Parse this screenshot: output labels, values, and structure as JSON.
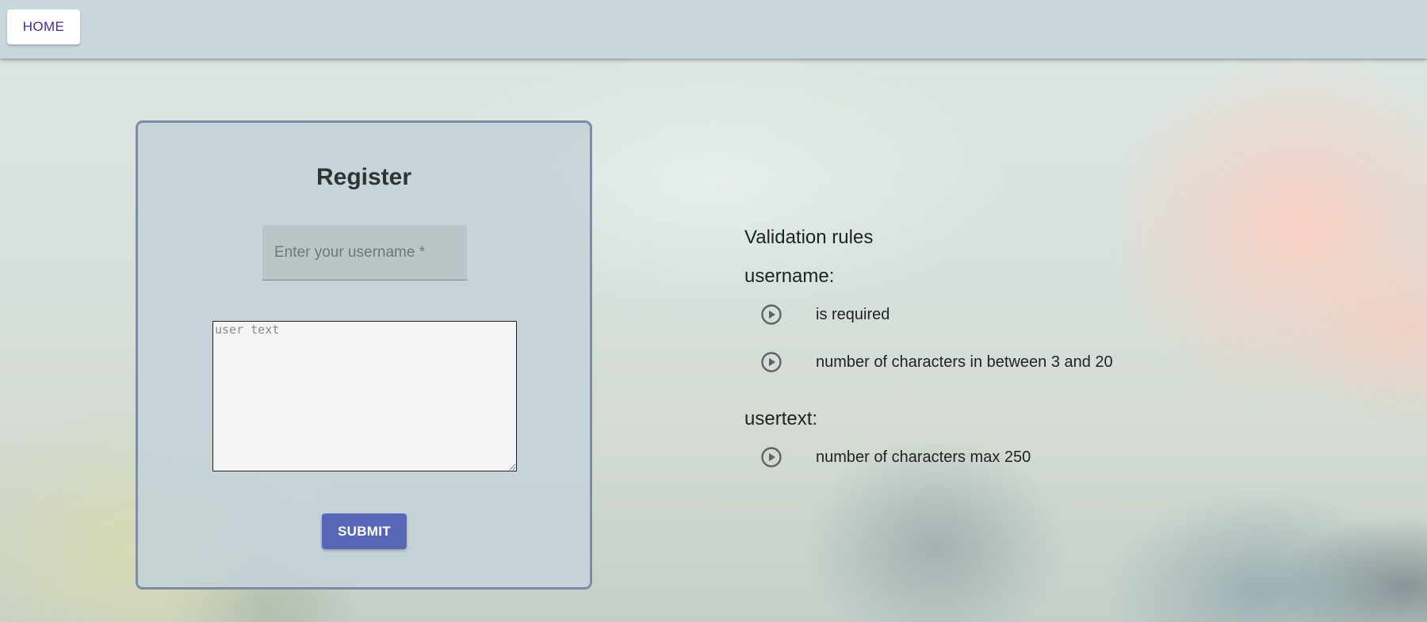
{
  "app_bar": {
    "home_label": "HOME"
  },
  "register_form": {
    "title": "Register",
    "username_placeholder": "Enter your username *",
    "username_value": "",
    "usertext_placeholder": "user text",
    "usertext_value": "",
    "submit_label": "SUBMIT"
  },
  "validation": {
    "title": "Validation rules",
    "sections": [
      {
        "name": "username:",
        "rules": [
          "is required",
          "number of characters in between 3 and 20"
        ]
      },
      {
        "name": "usertext:",
        "rules": [
          "number of characters max 250"
        ]
      }
    ]
  },
  "icons": {
    "rule_bullet": "play-circle-outline-icon"
  },
  "colors": {
    "app_bar": "#c9d8dd",
    "primary_button": "#5866b8",
    "home_text": "#4a2a92",
    "card_border": "#7b8ba8"
  }
}
